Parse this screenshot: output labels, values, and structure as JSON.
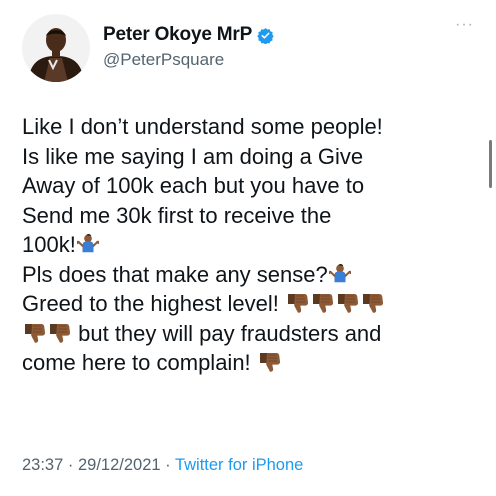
{
  "author": {
    "display_name": "Peter Okoye MrP",
    "handle": "@PeterPsquare",
    "verified": true
  },
  "more_label": "···",
  "tweet": {
    "lines": [
      "Like I don’t understand some people!",
      "Is like me saying I am doing a Give",
      "Away of 100k each but you have to",
      "Send me 30k first to receive the",
      "100k!",
      "Pls does that make any sense?",
      "Greed to the highest level!",
      "but they will pay fraudsters and",
      "come here to complain!"
    ],
    "emoji": {
      "shrug": "person-shrugging-emoji",
      "thumbs_down": "thumbs-down-emoji"
    }
  },
  "meta": {
    "time": "23:37",
    "date": "29/12/2021",
    "separator": " · ",
    "source": "Twitter for iPhone"
  },
  "colors": {
    "text": "#0f1419",
    "secondary": "#536471",
    "link": "#1d9bf0",
    "verified": "#1d9bf0",
    "emoji_skin": "#8d5a36"
  }
}
